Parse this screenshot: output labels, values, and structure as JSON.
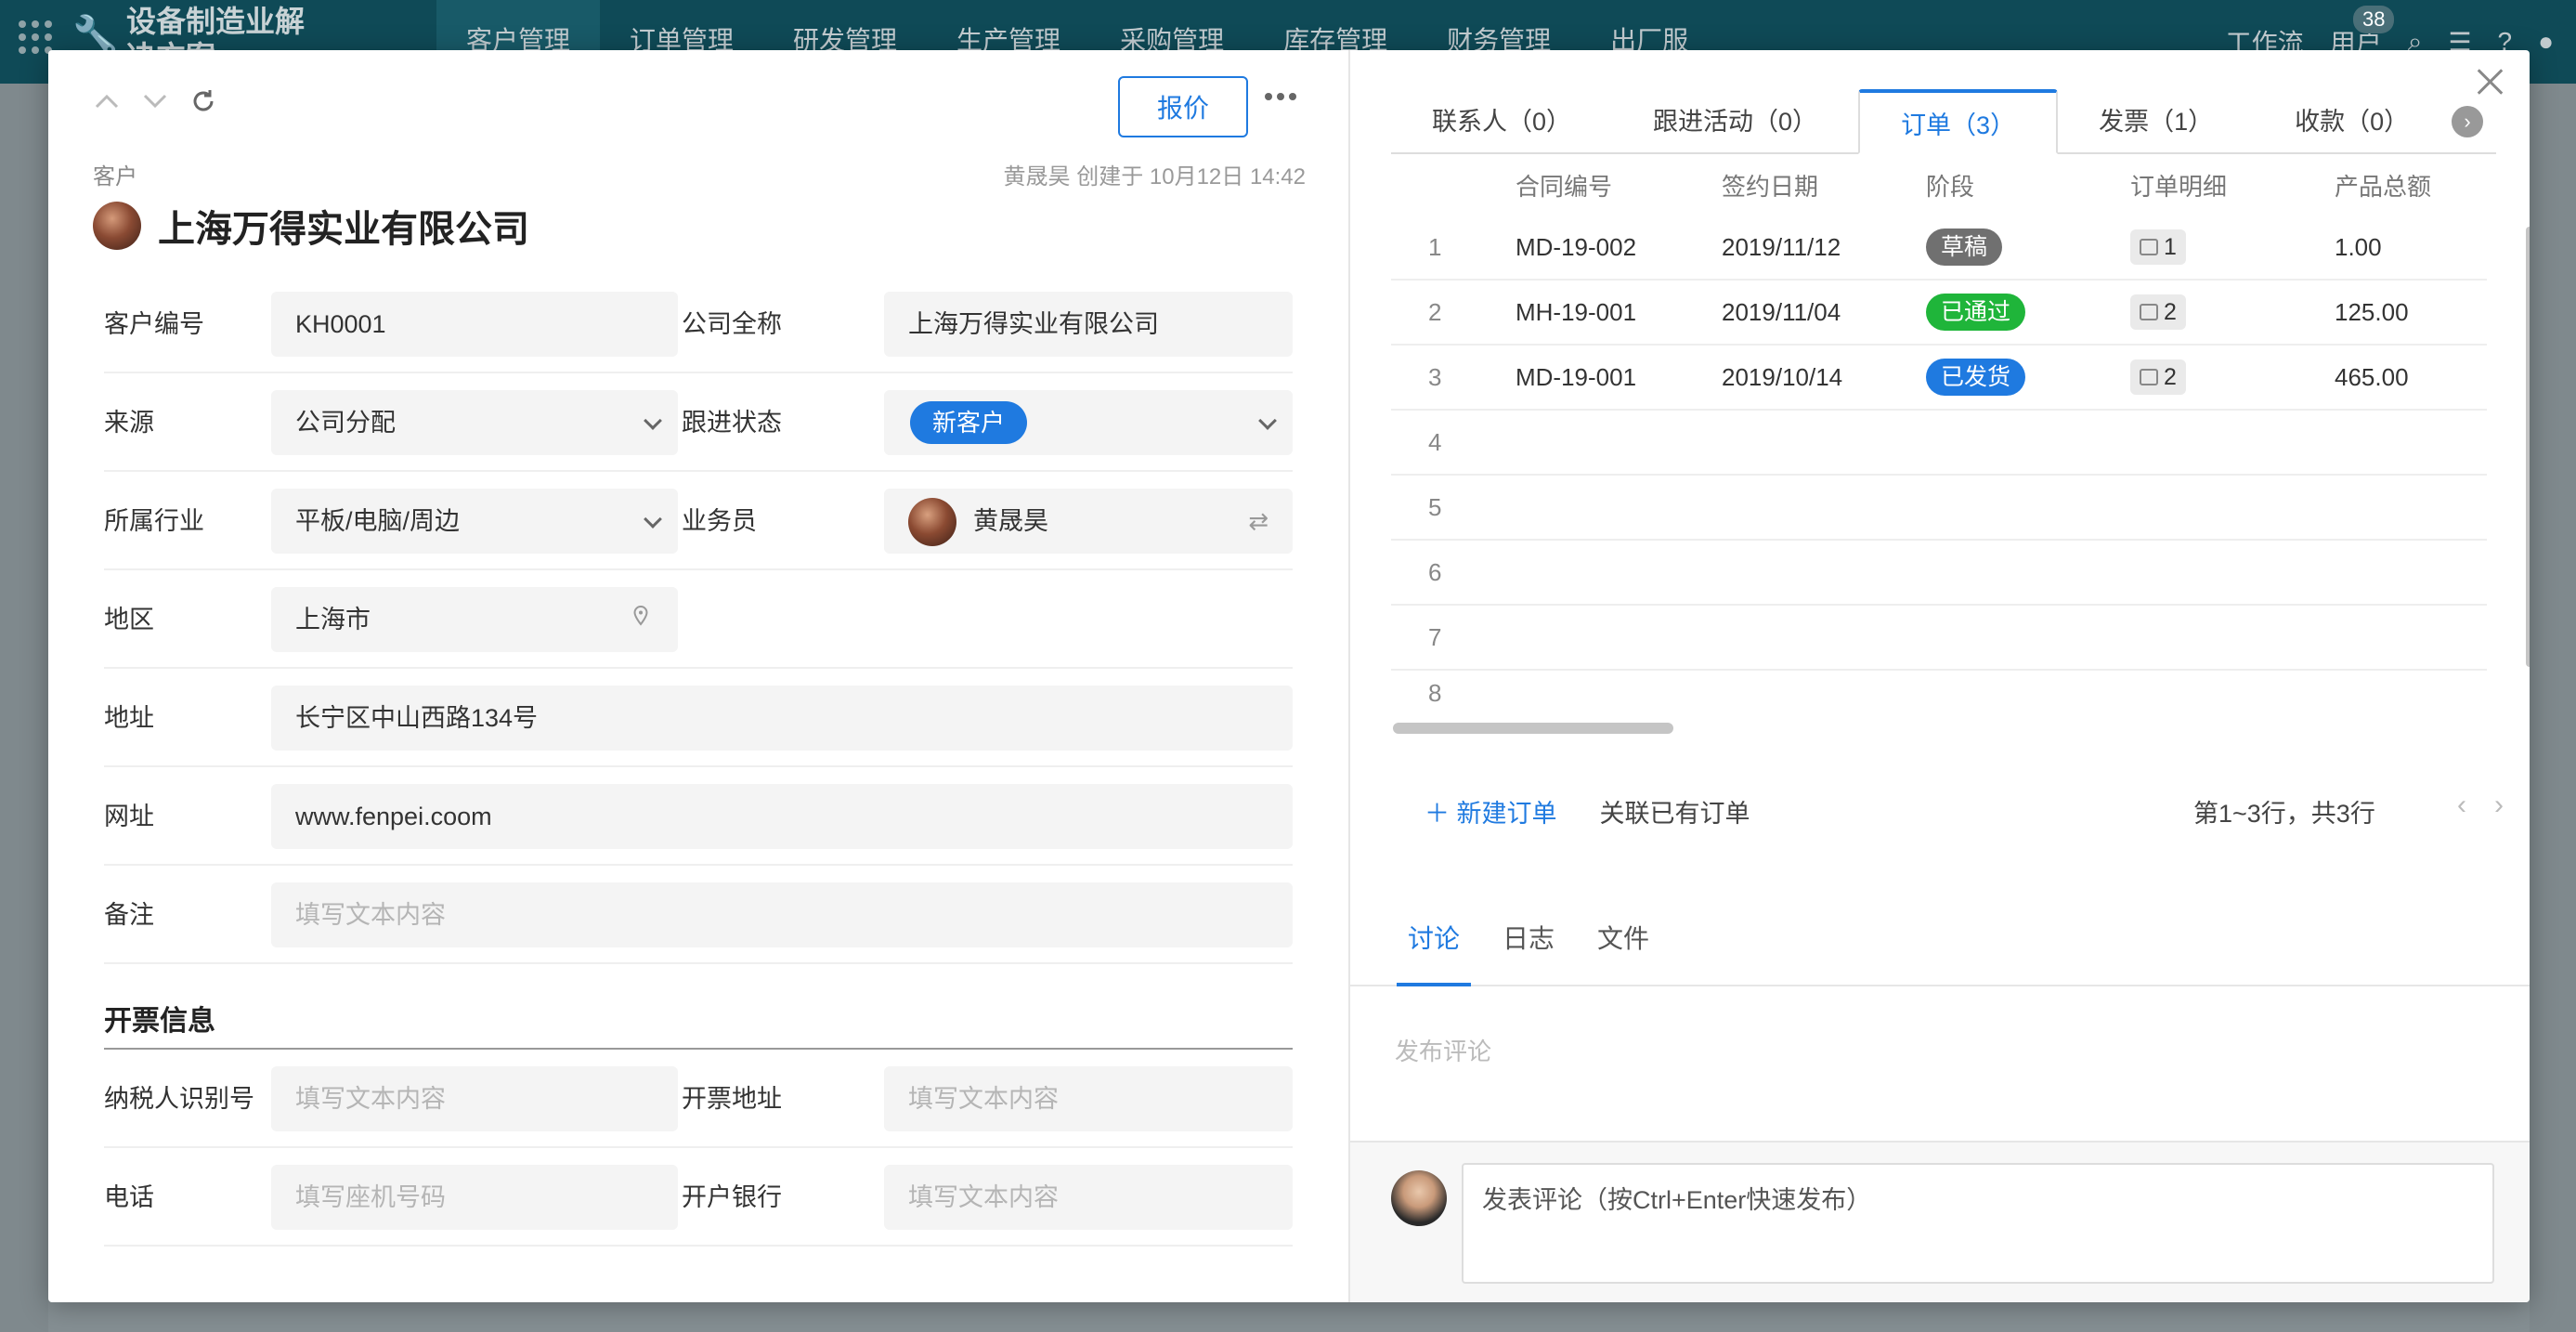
{
  "app": {
    "name": "设备制造业解决方案",
    "nav": [
      "客户管理",
      "订单管理",
      "研发管理",
      "生产管理",
      "采购管理",
      "库存管理",
      "财务管理",
      "出厂服"
    ],
    "right_items": [
      "工作流",
      "用户"
    ],
    "badge": "38"
  },
  "toolbar": {
    "quote_label": "报价"
  },
  "record": {
    "type_label": "客户",
    "meta": "黄晟昊 创建于 10月12日 14:42",
    "title": "上海万得实业有限公司"
  },
  "form": {
    "customer_no": {
      "label": "客户编号",
      "value": "KH0001"
    },
    "full_name": {
      "label": "公司全称",
      "value": "上海万得实业有限公司"
    },
    "source": {
      "label": "来源",
      "value": "公司分配"
    },
    "follow_status": {
      "label": "跟进状态",
      "value": "新客户"
    },
    "industry": {
      "label": "所属行业",
      "value": "平板/电脑/周边"
    },
    "salesperson": {
      "label": "业务员",
      "value": "黄晟昊"
    },
    "region": {
      "label": "地区",
      "value": "上海市"
    },
    "address": {
      "label": "地址",
      "value": "长宁区中山西路134号"
    },
    "website": {
      "label": "网址",
      "value": "www.fenpei.coom"
    },
    "remark": {
      "label": "备注",
      "placeholder": "填写文本内容"
    },
    "invoice_section": "开票信息",
    "tax_id": {
      "label": "纳税人识别号",
      "placeholder": "填写文本内容"
    },
    "invoice_addr": {
      "label": "开票地址",
      "placeholder": "填写文本内容"
    },
    "phone": {
      "label": "电话",
      "placeholder": "填写座机号码"
    },
    "bank": {
      "label": "开户银行",
      "placeholder": "填写文本内容"
    }
  },
  "tabs": [
    {
      "label": "联系人（0）"
    },
    {
      "label": "跟进活动（0）"
    },
    {
      "label": "订单（3）"
    },
    {
      "label": "发票（1）"
    },
    {
      "label": "收款（0）"
    }
  ],
  "orders": {
    "headers": [
      "合同编号",
      "签约日期",
      "阶段",
      "订单明细",
      "产品总额"
    ],
    "rows": [
      {
        "n": "1",
        "contract": "MD-19-002",
        "date": "2019/11/12",
        "stage": "草稿",
        "stage_color": "#707070",
        "detail": "1",
        "amount": "1.00"
      },
      {
        "n": "2",
        "contract": "MH-19-001",
        "date": "2019/11/04",
        "stage": "已通过",
        "stage_color": "#1fb53a",
        "detail": "2",
        "amount": "125.00"
      },
      {
        "n": "3",
        "contract": "MD-19-001",
        "date": "2019/10/14",
        "stage": "已发货",
        "stage_color": "#1f7ae0",
        "detail": "2",
        "amount": "465.00"
      }
    ],
    "empty_rows": [
      "4",
      "5",
      "6",
      "7",
      "8"
    ],
    "new_label": "新建订单",
    "link_label": "关联已有订单",
    "pager": "第1~3行，共3行"
  },
  "discussion": {
    "tabs": [
      "讨论",
      "日志",
      "文件"
    ],
    "placeholder": "发布评论",
    "input_placeholder": "发表评论（按Ctrl+Enter快速发布）"
  },
  "colors": {
    "accent": "#1f7ae0",
    "header_bg": "#0f4a57"
  }
}
